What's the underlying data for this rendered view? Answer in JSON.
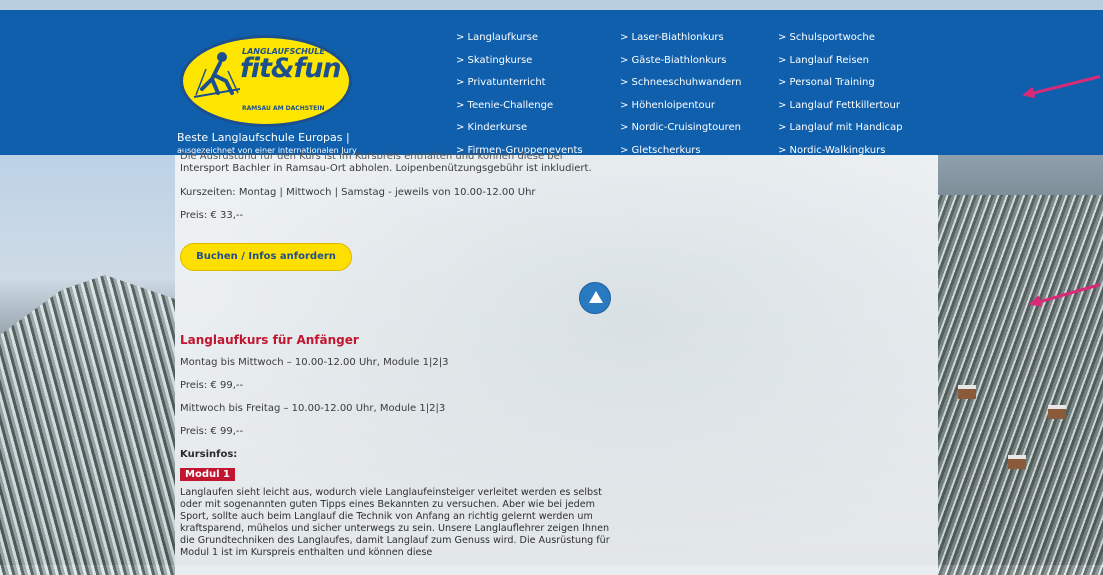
{
  "header": {
    "logo": {
      "school": "LANGLAUFSCHULE",
      "brand": "fit&fun",
      "location": "RAMSAU AM DACHSTEIN"
    },
    "tagline": "Beste Langlaufschule Europas |",
    "tagline_sub": "ausgezeichnet von einer internationalen Jury",
    "nav": {
      "col1": [
        "> Langlaufkurse",
        "> Skatingkurse",
        "> Privatunterricht",
        "> Teenie-Challenge",
        "> Kinderkurse",
        "> Firmen-Gruppenevents"
      ],
      "col2": [
        "> Laser-Biathlonkurs",
        "> Gäste-Biathlonkurs",
        "> Schneeschuhwandern",
        "> Höhenloipentour",
        "> Nordic-Cruisingtouren",
        "> Gletscherkurs"
      ],
      "col3": [
        "> Schulsportwoche",
        "> Langlauf Reisen",
        "> Personal Training",
        "> Langlauf Fettkillertour",
        "> Langlauf mit Handicap",
        "> Nordic-Walkingkurs"
      ]
    },
    "colors": {
      "header_bg": "#0f5fad",
      "logo_yellow": "#ffe600",
      "arrow": "#d92a7a"
    }
  },
  "content": {
    "cut_line": "Die Ausrüstung für den Kurs ist im Kurspreis enthalten und können diese bei",
    "line_equip": "Intersport Bachler in Ramsau-Ort abholen. Loipenbenützungsgebühr ist inkludiert.",
    "course_times": "Kurszeiten: Montag | Mittwoch | Samstag - jeweils von 10.00-12.00 Uhr",
    "price1": "Preis: € 33,--",
    "book_button": "Buchen / Infos anfordern",
    "course_title": "Langlaufkurs für Anfänger",
    "slot1": "Montag bis Mittwoch – 10.00-12.00 Uhr, Module 1|2|3",
    "price2": "Preis: € 99,--",
    "slot2": "Mittwoch bis Freitag – 10.00-12.00 Uhr, Module 1|2|3",
    "price3": "Preis: € 99,--",
    "kursinfos": "Kursinfos:",
    "module_badge": "Modul 1",
    "paragraph": "Langlaufen sieht leicht aus, wodurch viele Langlaufeinsteiger verleitet werden es selbst oder mit sogenannten guten Tipps eines Bekannten zu versuchen. Aber wie bei jedem Sport, sollte auch beim Langlauf die Technik von Anfang an richtig gelernt werden um kraftsparend, mühelos und sicher unterwegs zu sein. Unsere Langlauflehrer zeigen Ihnen die Grundtechniken des Langlaufes, damit Langlauf zum Genuss wird. Die Ausrüstung für Modul 1 ist im Kurspreis enthalten und können diese",
    "colors": {
      "title_red": "#c0162f",
      "button_yellow": "#ffdf00",
      "scroll_blue": "#2a7ac2"
    }
  }
}
